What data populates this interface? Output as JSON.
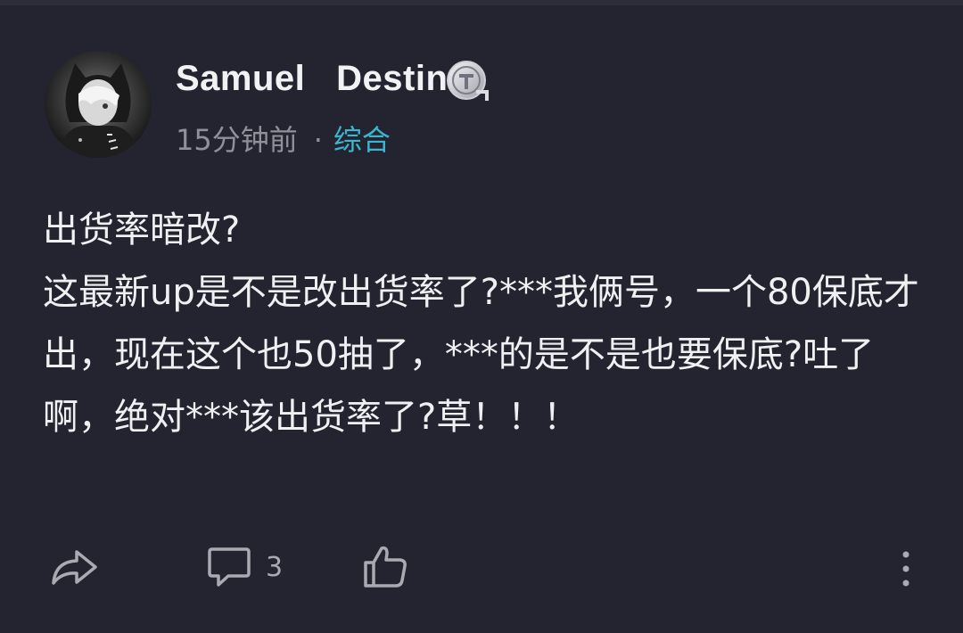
{
  "user": {
    "name": "Samuel   Destin",
    "badge_icon": "t-level-badge-icon"
  },
  "meta": {
    "time": "15分钟前",
    "separator": "·",
    "category": "综合"
  },
  "post": {
    "title": "出货率暗改?",
    "content": "这最新up是不是改出货率了?***我俩号，一个80保底才出，现在这个也50抽了，***的是不是也要保底?吐了啊，绝对***该出货率了?草！！！"
  },
  "actions": {
    "share_icon": "share-icon",
    "comment_icon": "comment-icon",
    "comment_count": "3",
    "like_icon": "thumbs-up-icon",
    "more_icon": "more-vertical-icon"
  },
  "colors": {
    "background": "#23242f",
    "text": "#f0f0f3",
    "muted": "#8f9099",
    "accent": "#3ab7cf"
  }
}
